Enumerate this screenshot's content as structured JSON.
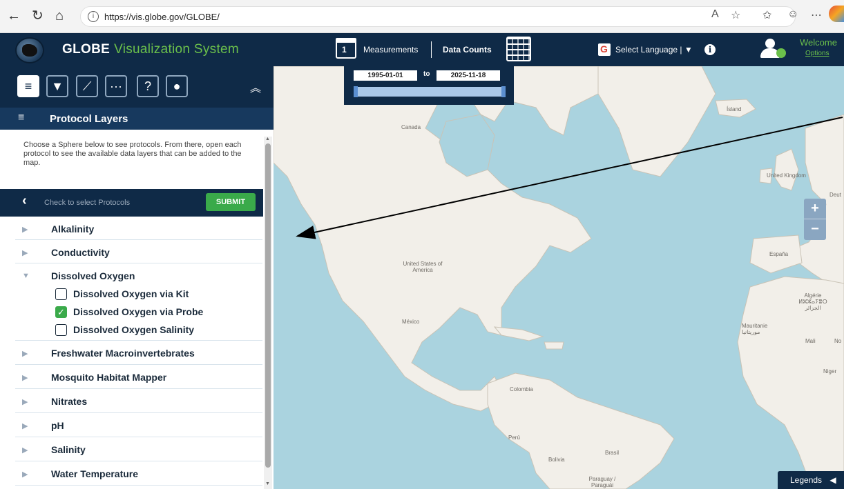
{
  "browser": {
    "url": "https://vis.globe.gov/GLOBE/",
    "icons": [
      "back-icon",
      "refresh-icon",
      "home-icon",
      "site-info-icon",
      "read-aloud-icon",
      "favorite-icon",
      "favorites-bar-icon",
      "profile-icon",
      "more-icon",
      "edge-copilot-icon"
    ]
  },
  "header": {
    "brand": "GLOBE",
    "subtitle": "Visualization System",
    "calendar_day": "1",
    "measurements_label": "Measurements",
    "data_counts_label": "Data Counts",
    "language_label": "Select Language | ▼",
    "info": "i",
    "welcome": "Welcome",
    "options": "Options"
  },
  "sidebar": {
    "tools": [
      "layers-icon",
      "filter-icon",
      "chart-icon",
      "more-icon",
      "help-icon",
      "user-settings-icon"
    ],
    "help_glyph": "?",
    "more_glyph": "···",
    "section_title": "Protocol Layers",
    "intro": "Choose a Sphere below to see protocols. From there, open each protocol to see the available data layers that can be added to the map.",
    "protocol_hint": "Check to select Protocols",
    "submit_label": "SUBMIT",
    "protocols": [
      {
        "label": "Alkalinity"
      },
      {
        "label": "Conductivity"
      },
      {
        "label": "Dissolved Oxygen"
      },
      {
        "label": "Freshwater Macroinvertebrates"
      },
      {
        "label": "Mosquito Habitat Mapper"
      },
      {
        "label": "Nitrates"
      },
      {
        "label": "pH"
      },
      {
        "label": "Salinity"
      },
      {
        "label": "Water Temperature"
      }
    ],
    "sub_protocols": [
      {
        "label": "Dissolved Oxygen via Kit",
        "checked": false
      },
      {
        "label": "Dissolved Oxygen via Probe",
        "checked": true
      },
      {
        "label": "Dissolved Oxygen Salinity",
        "checked": false
      }
    ]
  },
  "map": {
    "date_from": "1995-01-01",
    "date_to_label": "to",
    "date_to": "2025-11-18",
    "zoom_in": "+",
    "zoom_out": "−",
    "legends_label": "Legends",
    "labels": {
      "canada": "Canada",
      "island": "Ísland",
      "uk": "United Kingdom",
      "usa": "United States of America",
      "mexico": "México",
      "espana": "España",
      "algerie": "Algérie ⵍⵣⵣⴰⵢⴻⵔ الجزائر",
      "mauritanie": "Mauritanie موريتانيا",
      "mali": "Mali",
      "niger": "Niger",
      "colombia": "Colombia",
      "peru": "Perú",
      "brasil": "Brasil",
      "bolivia": "Bolivia",
      "paraguay": "Paraguay / Paraguái",
      "no": "No",
      "deut": "Deut"
    }
  },
  "colors": {
    "navy": "#0f2a47",
    "green": "#6bc04b",
    "submit_green": "#3aaa4a",
    "water": "#aad3df",
    "land": "#f2efe9"
  }
}
